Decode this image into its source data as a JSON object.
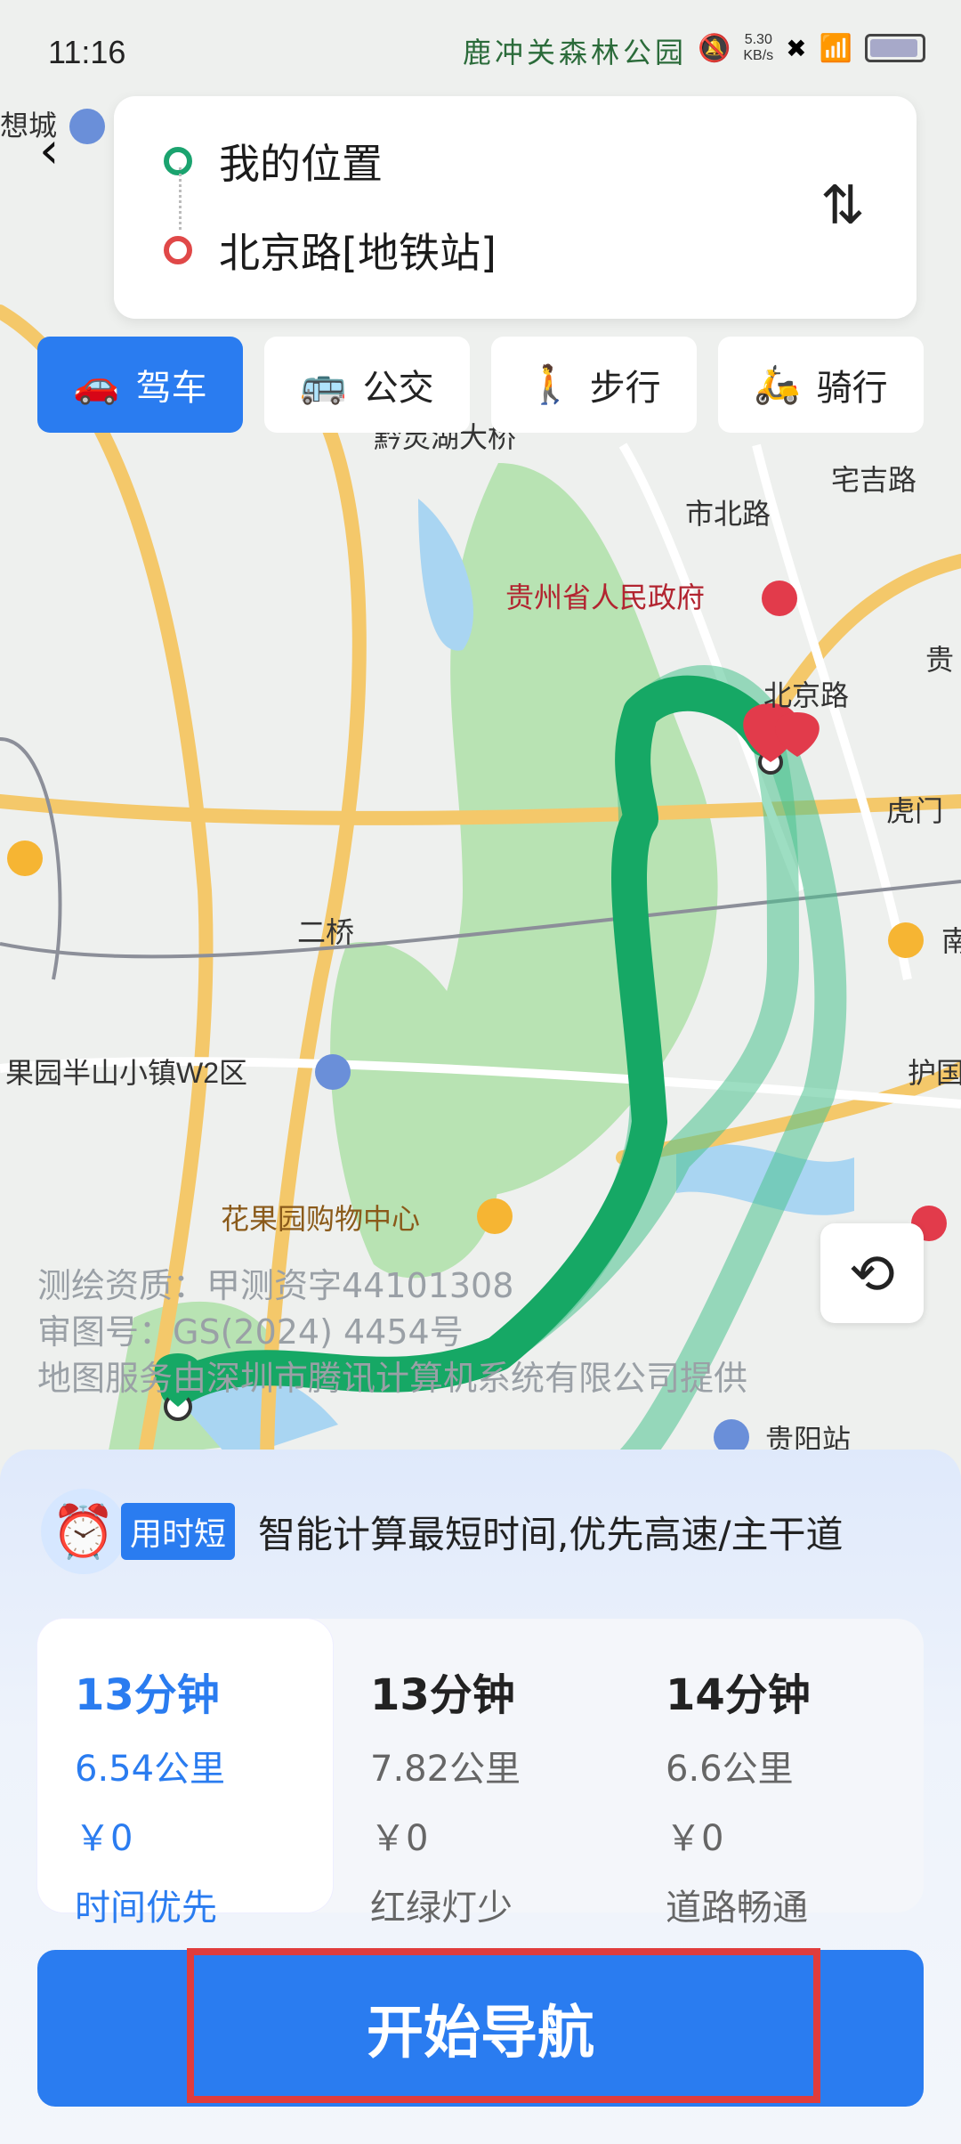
{
  "status_bar": {
    "time": "11:16",
    "map_place": "鹿冲关森林公园",
    "net_speed": "5.30\nKB/s"
  },
  "route": {
    "from": "我的位置",
    "to": "北京路[地铁站]",
    "swap_label": "⇅"
  },
  "modes": [
    {
      "label": "驾车",
      "icon": "car-icon",
      "active": true
    },
    {
      "label": "公交",
      "icon": "bus-icon",
      "active": false
    },
    {
      "label": "步行",
      "icon": "walk-icon",
      "active": false
    },
    {
      "label": "骑行",
      "icon": "scooter-icon",
      "active": false
    }
  ],
  "map": {
    "labels": [
      "黔灵湖大桥",
      "宅吉路",
      "市北路",
      "贵州省人民政府",
      "北京路",
      "虎门",
      "二桥",
      "果园半山小镇W2区",
      "花果园购物中心",
      "护国",
      "贵阳站",
      "南",
      "贵",
      "想城"
    ],
    "copyright": [
      "测绘资质：甲测资字44101308",
      "审图号：GS(2024) 4454号",
      "地图服务由深圳市腾讯计算机系统有限公司提供"
    ]
  },
  "panel": {
    "tip_tag": "用时短",
    "tip_text": "智能计算最短时间,优先高速/主干道",
    "options": [
      {
        "duration": "13分钟",
        "distance": "6.54公里",
        "cost": "￥0",
        "tag": "时间优先",
        "selected": true
      },
      {
        "duration": "13分钟",
        "distance": "7.82公里",
        "cost": "￥0",
        "tag": "红绿灯少",
        "selected": false
      },
      {
        "duration": "14分钟",
        "distance": "6.6公里",
        "cost": "￥0",
        "tag": "道路畅通",
        "selected": false
      }
    ],
    "start_button": "开始导航"
  },
  "colors": {
    "accent": "#2a7cf0",
    "route_green": "#1ba36f",
    "highlight_red": "#e03c3c"
  }
}
